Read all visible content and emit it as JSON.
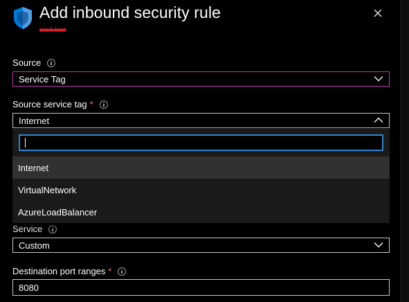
{
  "header": {
    "title": "Add inbound security rule",
    "subtitle": "cirrit-test",
    "icon": "shield-icon",
    "close_icon": "close-icon",
    "accent": "#0078d4"
  },
  "source": {
    "label": "Source",
    "value": "Service Tag"
  },
  "source_service_tag": {
    "label": "Source service tag",
    "required": "*",
    "value": "Internet",
    "search_value": "",
    "options": [
      "Internet",
      "VirtualNetwork",
      "AzureLoadBalancer"
    ],
    "selected": "Internet"
  },
  "service": {
    "label": "Service",
    "value": "Custom"
  },
  "destination_port_ranges": {
    "label": "Destination port ranges",
    "required": "*",
    "value": "8080"
  },
  "colors": {
    "focus_border": "#c239b3",
    "search_border": "#2b88d8",
    "required": "#f1707b",
    "redaction": "#e0202a"
  }
}
